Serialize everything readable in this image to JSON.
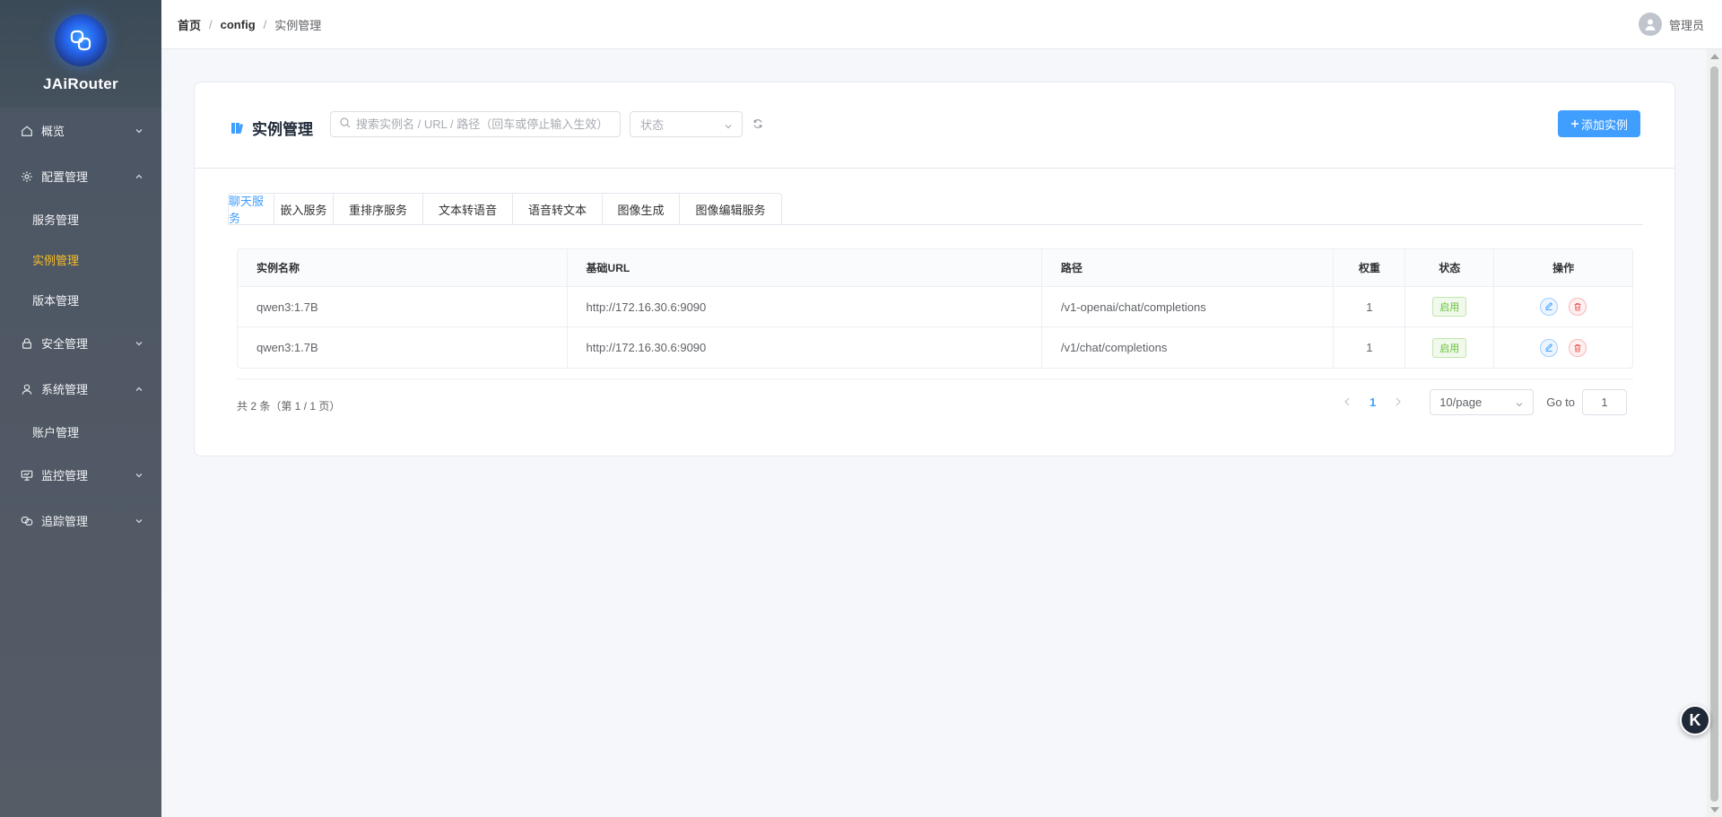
{
  "app": {
    "name": "JAiRouter"
  },
  "sidebar": {
    "groups": [
      {
        "label": "概览",
        "icon": "home-icon",
        "expanded": false,
        "items": []
      },
      {
        "label": "配置管理",
        "icon": "gear-icon",
        "expanded": true,
        "items": [
          {
            "label": "服务管理",
            "active": false
          },
          {
            "label": "实例管理",
            "active": true
          },
          {
            "label": "版本管理",
            "active": false
          }
        ]
      },
      {
        "label": "安全管理",
        "icon": "lock-icon",
        "expanded": false,
        "items": []
      },
      {
        "label": "系统管理",
        "icon": "user-icon",
        "expanded": true,
        "items": [
          {
            "label": "账户管理",
            "active": false
          }
        ]
      },
      {
        "label": "监控管理",
        "icon": "monitor-icon",
        "expanded": false,
        "items": []
      },
      {
        "label": "追踪管理",
        "icon": "trace-icon",
        "expanded": false,
        "items": []
      }
    ]
  },
  "header": {
    "breadcrumb": [
      "首页",
      "config",
      "实例管理"
    ],
    "user": "管理员"
  },
  "page": {
    "title": "实例管理",
    "search_placeholder": "搜索实例名 / URL / 路径（回车或停止输入生效）",
    "status_placeholder": "状态",
    "add_button": "添加实例"
  },
  "tabs": [
    {
      "label": "聊天服务",
      "active": true
    },
    {
      "label": "嵌入服务",
      "active": false
    },
    {
      "label": "重排序服务",
      "active": false
    },
    {
      "label": "文本转语音",
      "active": false
    },
    {
      "label": "语音转文本",
      "active": false
    },
    {
      "label": "图像生成",
      "active": false
    },
    {
      "label": "图像编辑服务",
      "active": false
    }
  ],
  "table": {
    "columns": [
      "实例名称",
      "基础URL",
      "路径",
      "权重",
      "状态",
      "操作"
    ],
    "rows": [
      {
        "name": "qwen3:1.7B",
        "url": "http://172.16.30.6:9090",
        "path": "/v1-openai/chat/completions",
        "weight": "1",
        "status": "启用"
      },
      {
        "name": "qwen3:1.7B",
        "url": "http://172.16.30.6:9090",
        "path": "/v1/chat/completions",
        "weight": "1",
        "status": "启用"
      }
    ]
  },
  "pagination": {
    "total_text": "共 2 条（第 1 / 1 页）",
    "current": "1",
    "page_size": "10/page",
    "goto_label": "Go to",
    "goto_value": "1"
  },
  "floating_button": {
    "label": "K"
  },
  "colors": {
    "primary": "#409eff",
    "sidebar_active": "#fbbf24",
    "success": "#67c23a",
    "danger": "#f56c6c"
  }
}
